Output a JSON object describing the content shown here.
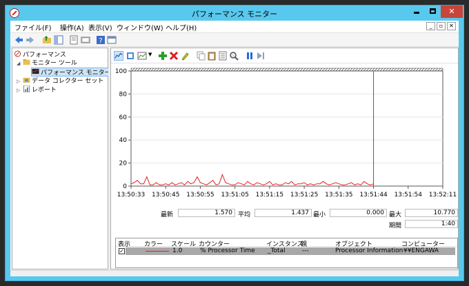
{
  "window": {
    "title": "パフォーマンス モニター"
  },
  "menu": {
    "items": [
      "ファイル(F)",
      "操作(A)",
      "表示(V)",
      "ウィンドウ(W)",
      "ヘルプ(H)"
    ]
  },
  "tree": {
    "root": "パフォーマンス",
    "monitor_tools": "モニター ツール",
    "perf_monitor": "パフォーマンス モニター",
    "data_collector": "データ コレクター セット",
    "reports": "レポート"
  },
  "chart_data": {
    "type": "line",
    "ylim": [
      0,
      100
    ],
    "y_ticks": [
      "100",
      "80",
      "60",
      "40",
      "20",
      "0"
    ],
    "x_ticks": [
      "13:50:33",
      "13:50:45",
      "13:50:55",
      "13:51:05",
      "13:51:15",
      "13:51:25",
      "13:51:35",
      "13:51:44",
      "13:51:54",
      "13:52:11"
    ],
    "series": [
      {
        "color": "#e02020",
        "values": [
          2,
          3,
          5,
          2,
          2,
          8,
          1,
          1,
          3,
          1,
          1,
          2,
          1,
          3,
          1,
          2,
          3,
          1,
          4,
          2,
          3,
          8,
          3,
          2,
          1,
          3,
          5,
          1,
          2,
          10,
          3,
          2,
          1,
          1,
          3,
          2,
          1,
          4,
          2,
          1,
          3,
          2,
          1,
          2,
          4,
          1,
          2,
          1,
          1,
          3,
          2,
          4,
          1,
          2,
          2,
          3,
          1,
          2,
          1,
          2,
          2,
          4,
          2,
          1,
          2,
          3,
          2,
          1,
          1,
          2,
          3,
          1,
          2,
          1,
          4,
          2,
          1,
          2
        ]
      }
    ],
    "current_marker_index": 77
  },
  "stats": {
    "last_label": "最新",
    "last_value": "1.570",
    "avg_label": "平均",
    "avg_value": "1.437",
    "min_label": "最小",
    "min_value": "0.000",
    "max_label": "最大",
    "max_value": "10.770",
    "duration_label": "期間",
    "duration_value": "1:40"
  },
  "legend": {
    "headers": [
      "表示",
      "カラー",
      "スケール",
      "カウンター",
      "インスタンス",
      "親",
      "オブジェクト",
      "コンピューター"
    ],
    "rows": [
      {
        "show": "✓",
        "scale": "1.0",
        "counter": "% Processor Time",
        "instance": "_Total",
        "parent": "---",
        "object": "Processor Information",
        "computer": "¥¥ENGAWA",
        "color": "#e02020"
      }
    ]
  },
  "colors": {
    "titlebar": "#59c8ee",
    "close": "#c7453b",
    "series": "#e02020"
  }
}
